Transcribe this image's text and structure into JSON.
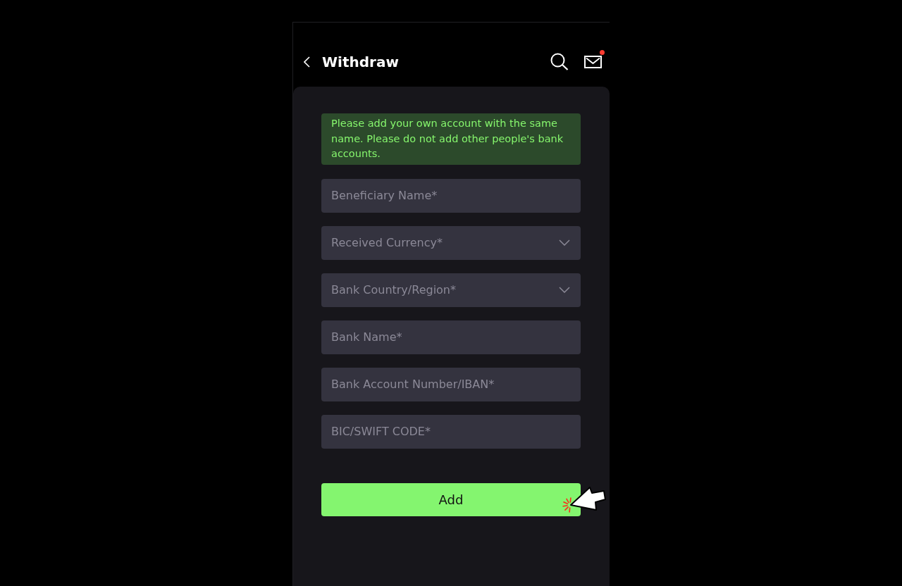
{
  "header": {
    "title": "Withdraw",
    "has_unread_messages": true
  },
  "notice": "Please add your own account with the same name. Please do not add other people's bank accounts.",
  "fields": [
    {
      "kind": "text",
      "placeholder": "Beneficiary Name*"
    },
    {
      "kind": "select",
      "placeholder": "Received Currency*"
    },
    {
      "kind": "select",
      "placeholder": "Bank Country/Region*"
    },
    {
      "kind": "text",
      "placeholder": "Bank Name*"
    },
    {
      "kind": "text",
      "placeholder": "Bank Account Number/IBAN*"
    },
    {
      "kind": "text",
      "placeholder": "BIC/SWIFT CODE*"
    }
  ],
  "submit_button": {
    "label": "Add"
  }
}
